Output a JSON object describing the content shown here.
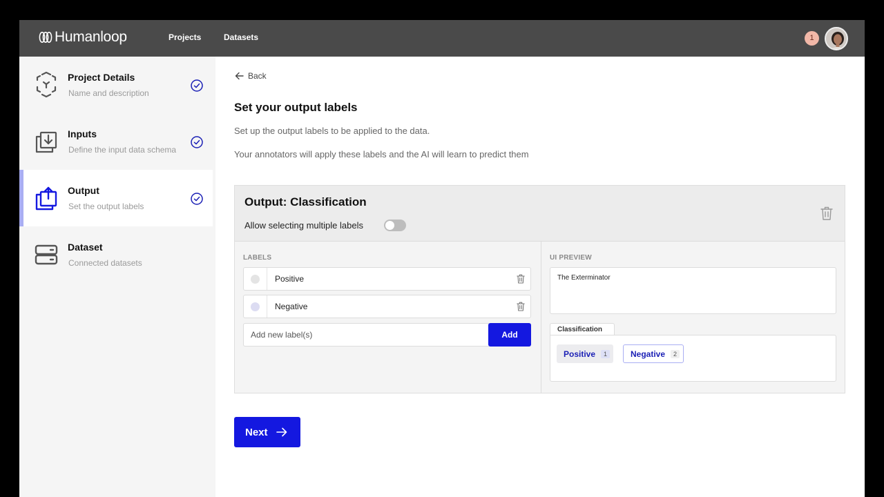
{
  "header": {
    "brand": "Humanloop",
    "nav": [
      {
        "label": "Projects"
      },
      {
        "label": "Datasets"
      }
    ],
    "notification_count": "1"
  },
  "sidebar": {
    "steps": [
      {
        "title": "Project Details",
        "subtitle": "Name and description",
        "icon": "cube-icon",
        "completed": true
      },
      {
        "title": "Inputs",
        "subtitle": "Define the input data schema",
        "icon": "import-icon",
        "completed": true
      },
      {
        "title": "Output",
        "subtitle": "Set the output labels",
        "icon": "export-icon",
        "completed": true,
        "active": true
      },
      {
        "title": "Dataset",
        "subtitle": "Connected datasets",
        "icon": "server-icon",
        "completed": false
      }
    ]
  },
  "main": {
    "back_label": "Back",
    "title": "Set your output labels",
    "description_1": "Set up the output labels to be applied to the data.",
    "description_2": "Your annotators will apply these labels and the AI will learn to predict them",
    "output_card": {
      "title": "Output: Classification",
      "multi_label": "Allow selecting multiple labels",
      "multi_enabled": false,
      "labels_heading": "LABELS",
      "labels": [
        {
          "text": "Positive",
          "color": "#e4e4e4"
        },
        {
          "text": "Negative",
          "color": "#dcdcf2"
        }
      ],
      "add_placeholder": "Add new label(s)",
      "add_button": "Add",
      "preview_heading": "UI PREVIEW",
      "preview_text": "The Exterminator",
      "classification_tab": "Classification",
      "chips": [
        {
          "label": "Positive",
          "shortcut": "1",
          "selected": true
        },
        {
          "label": "Negative",
          "shortcut": "2",
          "selected": false
        }
      ]
    },
    "next_button": "Next"
  },
  "colors": {
    "accent": "#1418e0",
    "header_bg": "#4a4a4a",
    "sidebar_bg": "#f5f5f5",
    "active_indicator": "#a9aef3",
    "badge_bg": "#f2b8a8"
  }
}
